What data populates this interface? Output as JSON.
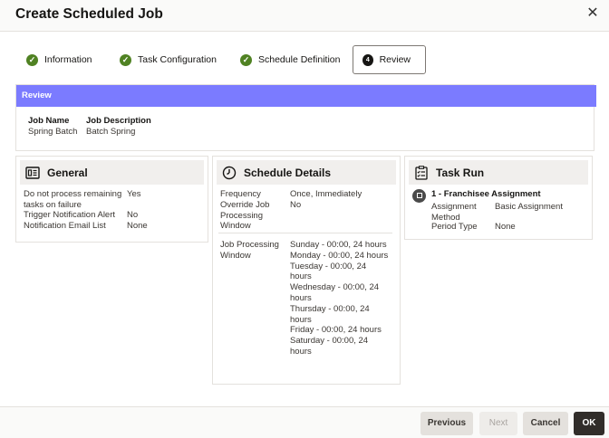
{
  "dialog": {
    "title": "Create Scheduled Job",
    "close_glyph": "✕"
  },
  "train": {
    "steps": [
      {
        "label": "Information",
        "state": "complete"
      },
      {
        "label": "Task Configuration",
        "state": "complete"
      },
      {
        "label": "Schedule Definition",
        "state": "complete"
      },
      {
        "label": "Review",
        "state": "current",
        "number": "4"
      }
    ],
    "check_glyph": "✓"
  },
  "review": {
    "bar_title": "Review",
    "job_name_label": "Job Name",
    "job_name_value": "Spring Batch",
    "job_desc_label": "Job Description",
    "job_desc_value": "Batch Spring",
    "bar_color": "#7b7bff"
  },
  "general": {
    "title": "General",
    "rows": [
      {
        "label": "Do not process remaining tasks on failure",
        "value": "Yes"
      },
      {
        "label": "Trigger Notification Alert",
        "value": "No"
      },
      {
        "label": "Notification Email List",
        "value": "None"
      }
    ]
  },
  "schedule": {
    "title": "Schedule Details",
    "frequency_label": "Frequency",
    "frequency_value": "Once, Immediately",
    "override_label": "Override Job Processing Window",
    "override_value": "No",
    "window_label": "Job Processing Window",
    "window_values": [
      "Sunday - 00:00, 24 hours",
      "Monday - 00:00, 24 hours",
      "Tuesday - 00:00, 24 hours",
      "Wednesday - 00:00, 24 hours",
      "Thursday - 00:00, 24 hours",
      "Friday - 00:00, 24 hours",
      "Saturday - 00:00, 24 hours"
    ]
  },
  "task_run": {
    "title": "Task Run",
    "task_title": "1 - Franchisee Assignment",
    "method_label": "Assignment Method",
    "method_value": "Basic Assignment",
    "period_label": "Period Type",
    "period_value": "None"
  },
  "footer": {
    "previous": "Previous",
    "next": "Next",
    "cancel": "Cancel",
    "ok": "OK"
  },
  "icons": {
    "general": "list-card-icon",
    "schedule": "clock-icon",
    "task_run": "checklist-icon",
    "task_item": "task-badge-icon"
  },
  "colors": {
    "success": "#508223",
    "primary_button": "#312d2a"
  }
}
